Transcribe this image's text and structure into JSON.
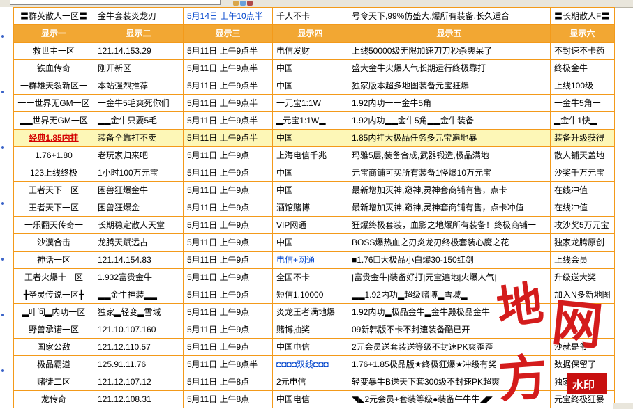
{
  "pinned": {
    "col1": "〓群英散人一区〓",
    "col2": "金牛套装炎龙刃",
    "col3": "5月14日 上午10点半",
    "col4": "千人不卡",
    "col5": "号令天下,99%仿盛大,爆所有装备.长久适合",
    "col6": "〓长期散人F〓"
  },
  "headers": [
    "显示一",
    "显示二",
    "显示三",
    "显示四",
    "显示五",
    "显示六"
  ],
  "rows": [
    {
      "c1": "救世主一区",
      "c2": "121.14.153.29",
      "c3": "5月11日 上午9点半",
      "c4": "电信发财",
      "c5": "上线50000级无限加速刀刀秒杀爽呆了",
      "c6": "不封速不卡药"
    },
    {
      "c1": "铁血传奇",
      "c2": "刚开新区",
      "c3": "5月11日 上午9点半",
      "c4": "中国",
      "c5": "盛大金牛火爆人气长期运行终极靠打",
      "c6": "终极金牛"
    },
    {
      "c1": "一群雄天裂新区一",
      "c2": "本站强烈推荐",
      "c3": "5月11日 上午9点半",
      "c4": "中国",
      "c5": "独家版本超多地图装备元宝狂爆",
      "c6": "上线100级"
    },
    {
      "c1": "一一世界无GM一区",
      "c2": "一金牛5毛爽死你们",
      "c3": "5月11日 上午9点半",
      "c4": "一元宝1:1W",
      "c5": "1.92内功一一金牛5角",
      "c6": "一金牛5角一"
    },
    {
      "c1": "▂▂世界无GM一区",
      "c2": "▂▂金牛只要5毛",
      "c3": "5月11日 上午9点半",
      "c4": "▂元宝1:1W▂",
      "c5": "1.92内功▂▂金牛5角▂▂金牛装备",
      "c6": "▂金牛1快▂"
    },
    {
      "c1": "经典1.85内挂",
      "c2": "装备全靠打不卖",
      "c3": "5月11日 上午9点半",
      "c4": "中国",
      "c5": "1.85内挂大极品任务多元宝遍地暴",
      "c6": "装备升级获得",
      "hl": true
    },
    {
      "c1": "1.76+1.80",
      "c2": "老玩家归来吧",
      "c3": "5月11日 上午9点",
      "c4": "上海电信千兆",
      "c5": "玛雅5层,装备合成,武器锻造,极品满地",
      "c6": "散人铺天盖地"
    },
    {
      "c1": "123上线终极",
      "c2": "1小时100万元宝",
      "c3": "5月11日 上午9点",
      "c4": "中国",
      "c5": "元宝商铺可买所有装备1怪爆10万元宝",
      "c6": "沙奖千万元宝"
    },
    {
      "c1": "王者天下一区",
      "c2": "困兽狂爆金牛",
      "c3": "5月11日 上午9点",
      "c4": "中国",
      "c5": "最新增加灭神,窥神,灵神套商铺有售，点卡",
      "c6": "在线冲值"
    },
    {
      "c1": "王者天下一区",
      "c2": "困兽狂爆金",
      "c3": "5月11日 上午9点",
      "c4": "酒馆赌博",
      "c5": "最新增加灭神,窥神,灵神套商铺有售，点卡冲值",
      "c6": "在线冲值"
    },
    {
      "c1": "一乐翻天传奇一",
      "c2": "长期稳定散人天堂",
      "c3": "5月11日 上午9点",
      "c4": "VIP网通",
      "c5": "狂爆终极套装，血影之地爆所有装备！终极商铺一",
      "c6": "攻沙奖5万元宝"
    },
    {
      "c1": "沙漠合击",
      "c2": "龙腾天赋远古",
      "c3": "5月11日 上午9点",
      "c4": "中国",
      "c5": "BOSS爆热血之刃炎龙刃终极套装心魔之花",
      "c6": "独家龙腾原创"
    },
    {
      "c1": "神话一区",
      "c2": "121.14.154.83",
      "c3": "5月11日 上午9点",
      "c4": "电信+网通",
      "c5": "■1.76☐大极品小白爆30-150红剑",
      "c6": "上线会员",
      "c4blue": true
    },
    {
      "c1": "王者火爆十一区",
      "c2": "1.932富贵金牛",
      "c3": "5月11日 上午9点",
      "c4": "全国不卡",
      "c5": "|富贵金牛|装备好打|元宝遍地|火爆人气|",
      "c6": "升级送大奖"
    },
    {
      "c1": "╋圣灵传说一区╋",
      "c2": "▂▂金牛神装▂▂",
      "c3": "5月11日 上午9点",
      "c4": "短信1.10000",
      "c5": "▂▂1.92内功▂超级赌博▂雪域▂",
      "c6": "加入N多新地图"
    },
    {
      "c1": "▂叶问▂内功一区",
      "c2": "独家▂轻变▂雪域",
      "c3": "5月11日 上午9点",
      "c4": "炎龙王者满地爆",
      "c5": "1.92内功▂极品金牛▂金牛殿极品金牛",
      "c6": ""
    },
    {
      "c1": "野兽承诺一区",
      "c2": "121.10.107.160",
      "c3": "5月11日 上午9点",
      "c4": "赌博抽奖",
      "c5": "09新韩版不卡不封速装备酷已开",
      "c6": ""
    },
    {
      "c1": "国家公敌",
      "c2": "121.12.110.57",
      "c3": "5月11日 上午9点",
      "c4": "中国电信",
      "c5": "2元会员送套装送等级不封速PK爽歪歪",
      "c6": "沙就是爷"
    },
    {
      "c1": "极品霸道",
      "c2": "125.91.11.76",
      "c3": "5月11日 上午8点半",
      "c4": "◘◘◘◘双线◘◘◘",
      "c5": "1.76+1.85极品版★终极狂爆★冲级有奖",
      "c6": "数据保留了",
      "c4blue": true
    },
    {
      "c1": "赌徒二区",
      "c2": "121.12.107.12",
      "c3": "5月11日 上午8点",
      "c4": "2元电信",
      "c5": "轻变暴牛B送天下套300级不封速PK超爽",
      "c6": "独家元宝"
    },
    {
      "c1": "龙传奇",
      "c2": "121.12.108.31",
      "c3": "5月11日 上午8点",
      "c4": "中国电信",
      "c5": "◥◣2元会员+套装等级●装备牛牛牛◢◤",
      "c6": "元宝终极狂暴"
    }
  ],
  "watermark": {
    "chars": [
      "地",
      "网",
      "方"
    ],
    "stamp": "水印"
  },
  "colors": {
    "border": "#f39a1a",
    "header_bg": "#f2a733",
    "highlight_bg": "#fdf7b7",
    "seal_red": "#d41c1c"
  }
}
